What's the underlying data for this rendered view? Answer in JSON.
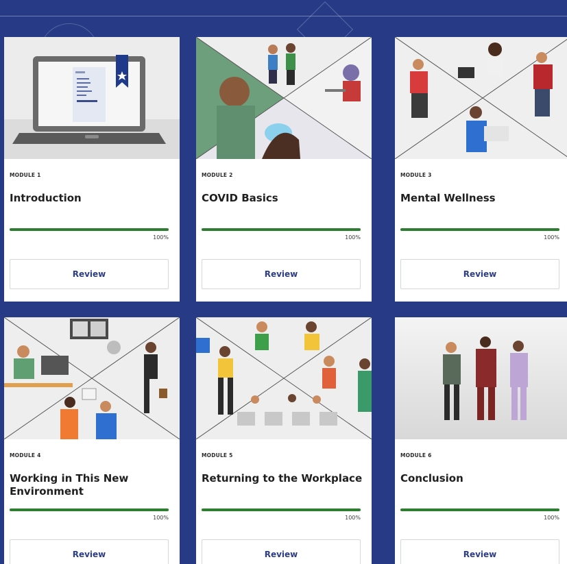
{
  "colors": {
    "background": "#263a86",
    "card": "#ffffff",
    "progress": "#2f7d32",
    "button_text": "#2c3d86"
  },
  "modules": [
    {
      "label": "MODULE 1",
      "title": "Introduction",
      "progress_text": "100%",
      "progress": 1.0,
      "button": "Review",
      "image": "laptop-with-bookmark-illustration"
    },
    {
      "label": "MODULE 2",
      "title": "COVID Basics",
      "progress_text": "100%",
      "progress": 1.0,
      "button": "Review",
      "image": "people-masks-handwashing-illustration"
    },
    {
      "label": "MODULE 3",
      "title": "Mental Wellness",
      "progress_text": "100%",
      "progress": 1.0,
      "button": "Review",
      "image": "people-relaxing-devices-illustration"
    },
    {
      "label": "MODULE 4",
      "title": "Working in This New Environment",
      "progress_text": "100%",
      "progress": 1.0,
      "button": "Review",
      "image": "office-meeting-masks-illustration"
    },
    {
      "label": "MODULE 5",
      "title": "Returning to the Workplace",
      "progress_text": "100%",
      "progress": 1.0,
      "button": "Review",
      "image": "workplace-waiting-room-illustration"
    },
    {
      "label": "MODULE 6",
      "title": "Conclusion",
      "progress_text": "100%",
      "progress": 1.0,
      "button": "Review",
      "image": "three-colleagues-waving-illustration"
    }
  ]
}
